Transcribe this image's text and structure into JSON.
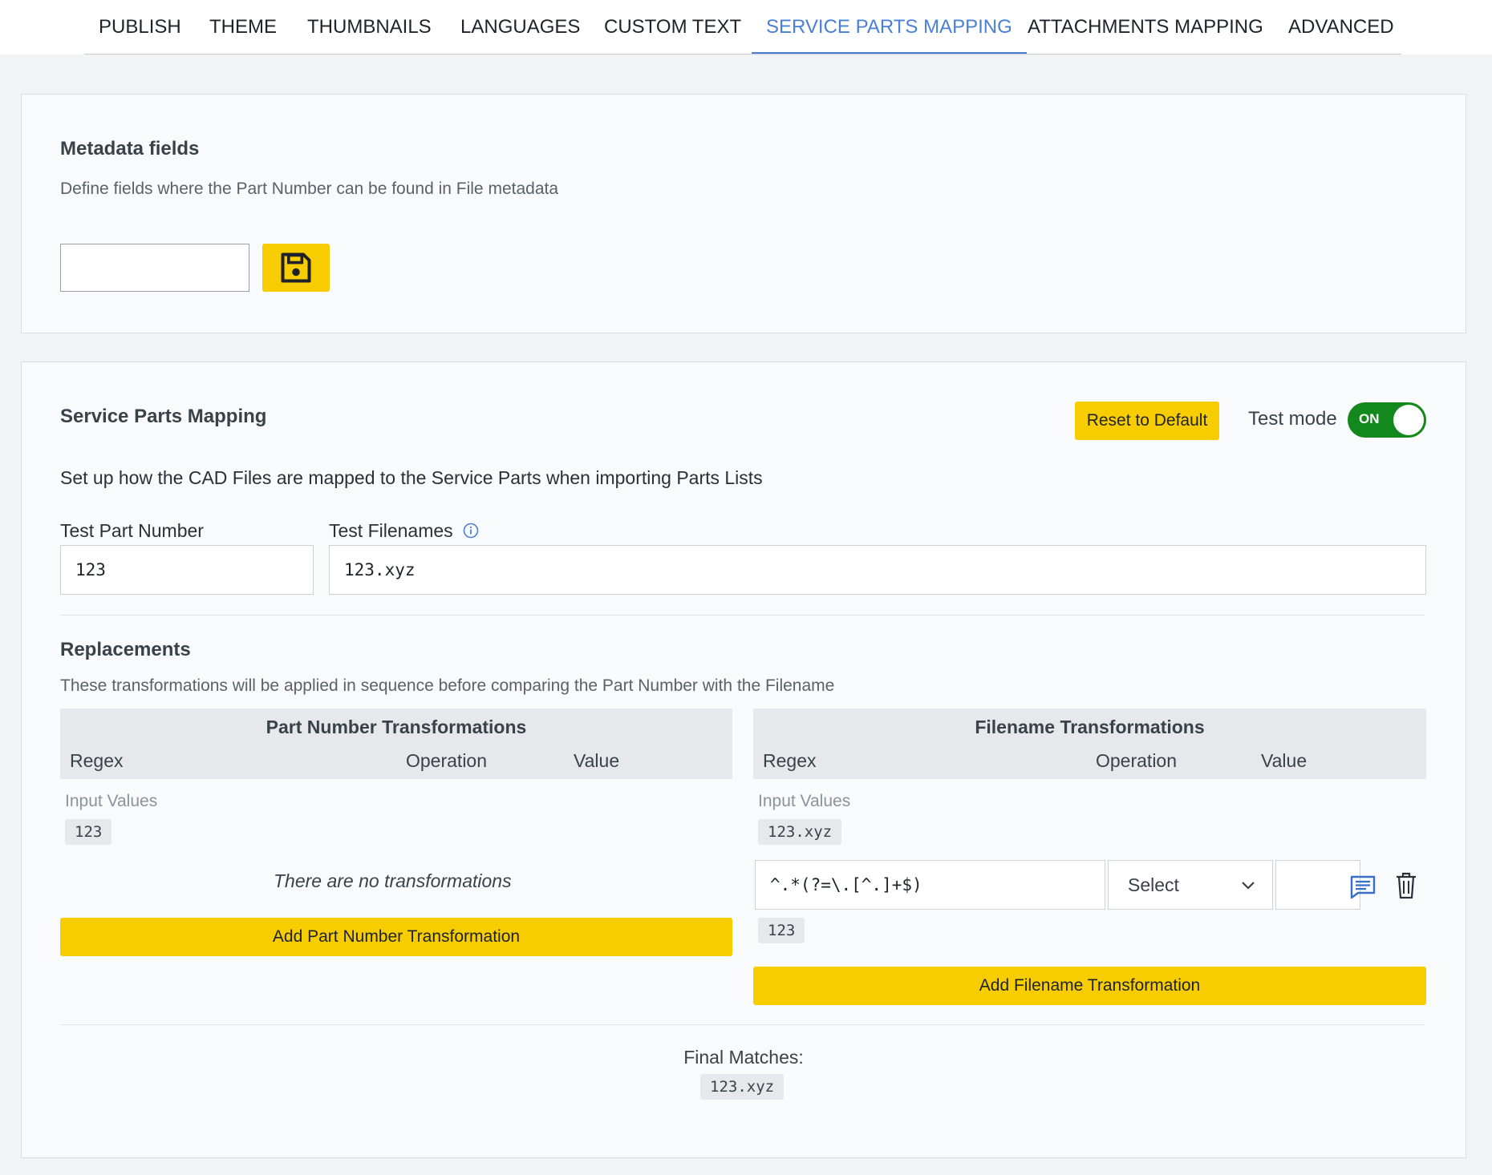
{
  "tabs": [
    {
      "label": "PUBLISH"
    },
    {
      "label": "THEME"
    },
    {
      "label": "THUMBNAILS"
    },
    {
      "label": "LANGUAGES"
    },
    {
      "label": "CUSTOM TEXT"
    },
    {
      "label": "SERVICE PARTS MAPPING",
      "active": true
    },
    {
      "label": "ATTACHMENTS MAPPING"
    },
    {
      "label": "ADVANCED"
    }
  ],
  "metadata": {
    "title": "Metadata fields",
    "description": "Define fields where the Part Number can be found in File metadata",
    "input_value": ""
  },
  "spm": {
    "title": "Service Parts Mapping",
    "reset_label": "Reset to Default",
    "test_mode_label": "Test mode",
    "toggle_label": "ON",
    "description": "Set up how the CAD Files are mapped to the Service Parts when importing Parts Lists",
    "test_part_number_label": "Test Part Number",
    "test_part_number_value": "123",
    "test_filenames_label": "Test Filenames",
    "test_filenames_value": "123.xyz"
  },
  "replacements": {
    "title": "Replacements",
    "description": "These transformations will be applied in sequence before comparing the Part Number with the Filename",
    "part": {
      "title": "Part Number Transformations",
      "col_regex": "Regex",
      "col_operation": "Operation",
      "col_value": "Value",
      "input_values_label": "Input Values",
      "input_value": "123",
      "empty_text": "There are no transformations",
      "add_label": "Add Part Number Transformation"
    },
    "file": {
      "title": "Filename Transformations",
      "col_regex": "Regex",
      "col_operation": "Operation",
      "col_value": "Value",
      "input_values_label": "Input Values",
      "input_value": "123.xyz",
      "row_regex": "^.*(?=\\.[^.]+$)",
      "row_operation": "Select",
      "row_value": "",
      "row_result": "123",
      "add_label": "Add Filename Transformation"
    }
  },
  "final": {
    "label": "Final Matches:",
    "value": "123.xyz"
  },
  "colors": {
    "accent": "#4a7fd6",
    "button_yellow": "#f7cd00",
    "toggle_green": "#13881c"
  }
}
